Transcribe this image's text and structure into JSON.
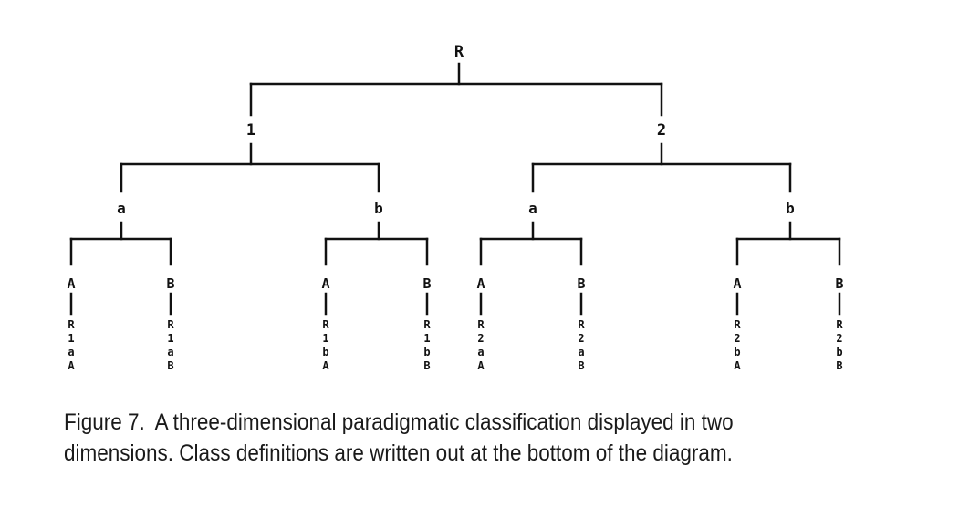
{
  "diagram": {
    "root": "R",
    "level1": [
      "1",
      "2"
    ],
    "level2": [
      "a",
      "b",
      "a",
      "b"
    ],
    "level3": [
      "A",
      "B",
      "A",
      "B",
      "A",
      "B",
      "A",
      "B"
    ],
    "class_definitions": [
      "R1aA",
      "R1aB",
      "R1bA",
      "R1bB",
      "R2aA",
      "R2aB",
      "R2bA",
      "R2bB"
    ]
  },
  "caption": {
    "figure_label": "Figure 7.",
    "text": "A three-dimensional paradigmatic classification displayed in two dimensions. Class definitions are written out at the bottom of the diagram."
  }
}
